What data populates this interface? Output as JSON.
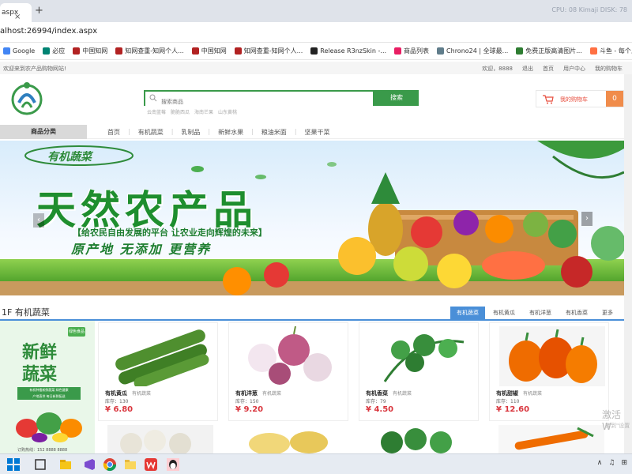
{
  "browser": {
    "tab_title": "aspx",
    "tab_close": "×",
    "tab_new": "+",
    "tab_right_text": "CPU: 08   Kimaji   DISK: 78",
    "address": "alhost:26994/index.aspx"
  },
  "bookmarks": [
    {
      "label": "Google",
      "color": "#4285f4"
    },
    {
      "label": "必应",
      "color": "#008373"
    },
    {
      "label": "中国知网",
      "color": "#b22222"
    },
    {
      "label": "知网查重-知网个人...",
      "color": "#b22222"
    },
    {
      "label": "中国知网",
      "color": "#b22222"
    },
    {
      "label": "知网查重-知网个人...",
      "color": "#b22222"
    },
    {
      "label": "Release R3nzSkin -...",
      "color": "#222222"
    },
    {
      "label": "商品列表",
      "color": "#e91e63"
    },
    {
      "label": "Chrono24 | 全球最...",
      "color": "#607d8b"
    },
    {
      "label": "免费正版高清图片...",
      "color": "#2e7d32"
    },
    {
      "label": "斗鱼 - 每个人的直...",
      "color": "#ff7043"
    }
  ],
  "topstrip": {
    "welcome": "欢迎来到农产品购物网站!",
    "links": [
      "欢迎，8888",
      "退出",
      "首页",
      "用户中心",
      "我的购物车"
    ]
  },
  "header": {
    "search_placeholder": "搜索商品",
    "search_button": "搜索",
    "hot_words": [
      "云南蓝莓",
      "脆脆西瓜",
      "海南芒果",
      "山东黄桃"
    ],
    "cart_label": "我的购物车",
    "cart_count": "0"
  },
  "nav": {
    "category": "商品分类",
    "links": [
      "首页",
      "有机蔬菜",
      "乳制品",
      "新鲜水果",
      "粮油米面",
      "坚果干菜"
    ]
  },
  "banner": {
    "logo_text": "有机蔬菜",
    "title": "天然农产品",
    "sub1": "【给农民自由发展的平台  让农业走向辉煌的未来】",
    "sub2": "原产地   无添加   更营养",
    "arrow_left": "‹",
    "arrow_right": "›"
  },
  "floor": {
    "title": "1F 有机蔬菜",
    "tabs": [
      "有机蔬菜",
      "有机黄瓜",
      "有机洋葱",
      "有机香菜",
      "更多"
    ],
    "active_tab": 0,
    "ad": {
      "badge": "绿色食品",
      "title1": "新鲜",
      "title2": "蔬菜",
      "note1": "有机种植新鲜蔬菜 绿色健康",
      "note2": "产地直供 每日新鲜配送",
      "phone": "订购热线：152 8888 8888"
    },
    "products": [
      {
        "name": "有机黄瓜",
        "category": "有机蔬菜",
        "stock": "库存：130",
        "price": "¥ 6.80",
        "image": "cucumber"
      },
      {
        "name": "有机洋葱",
        "category": "有机蔬菜",
        "stock": "库存：150",
        "price": "¥ 9.20",
        "image": "onion"
      },
      {
        "name": "有机香菜",
        "category": "有机蔬菜",
        "stock": "库存：79",
        "price": "¥ 4.50",
        "image": "coriander"
      },
      {
        "name": "有机甜椒",
        "category": "有机蔬菜",
        "stock": "库存：110",
        "price": "¥ 12.60",
        "image": "pepper"
      }
    ]
  },
  "watermark": {
    "line1": "激活 W",
    "line2": "转到\"设置"
  },
  "taskbar": {
    "right": [
      "∧",
      "♫",
      "⊞"
    ]
  },
  "colors": {
    "brand_green": "#3a9a4a",
    "price_red": "#d9363e",
    "tab_blue": "#4a8fd8",
    "cart_orange": "#f08c4b"
  }
}
